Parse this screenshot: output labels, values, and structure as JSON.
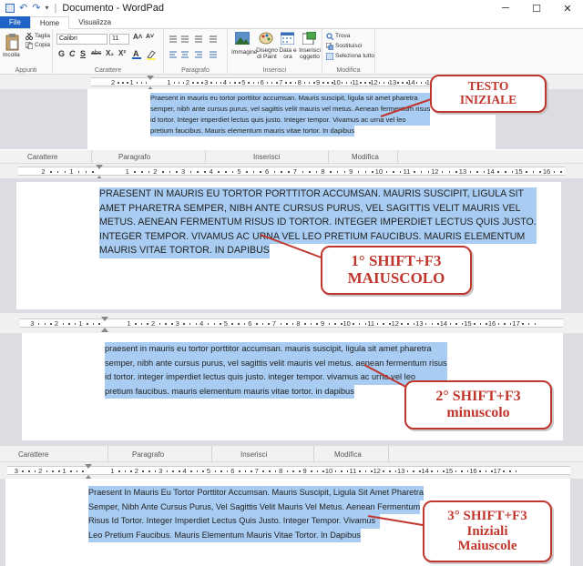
{
  "window": {
    "title": "Documento - WordPad",
    "title_sep": "|",
    "minimize": "─",
    "maximize": "☐",
    "close": "✕"
  },
  "quick_access": {
    "undo": "↶",
    "redo": "↷",
    "dropdown": "▾"
  },
  "tabs": [
    {
      "label": "File"
    },
    {
      "label": "Home"
    },
    {
      "label": "Visualizza"
    }
  ],
  "ribbon": {
    "clipboard": {
      "paste": "Incolla",
      "cut": "Taglia",
      "copy": "Copia",
      "group": "Appunti"
    },
    "font": {
      "family": "Calibri",
      "size": "11",
      "grow": "A˄",
      "shrink": "A˅",
      "bold": "G",
      "italic": "C",
      "underline": "S",
      "strike": "abc",
      "subscript": "X₂",
      "superscript": "X²",
      "group": "Carattere"
    },
    "paragraph": {
      "group": "Paragrafo"
    },
    "insert": {
      "image": "Immagine",
      "paint": "Disegno di Paint",
      "date": "Data e ora",
      "object": "Inserisci oggetto",
      "group": "Inserisci"
    },
    "editing": {
      "find": "Trova",
      "replace": "Sostituisci",
      "select_all": "Seleziona tutto",
      "group": "Modifica"
    }
  },
  "group_bar_labels": [
    "Carattere",
    "Paragrafo",
    "Inserisci",
    "Modifica"
  ],
  "ruler_numbers": [
    "3",
    "2",
    "1",
    "1",
    "2",
    "3",
    "4",
    "5",
    "6",
    "7",
    "8",
    "9",
    "10",
    "11",
    "12",
    "13",
    "14",
    "15",
    "16",
    "17"
  ],
  "panels": {
    "initial": {
      "lines": [
        "Praesent in mauris eu tortor porttitor accumsan. Mauris suscipit, ligula sit amet pharetra",
        "semper, nibh ante cursus purus, vel sagittis velit mauris vel metus. Aenean fermentum risus",
        "id tortor. Integer imperdiet lectus quis justo. Integer tempor. Vivamus ac urna vel leo",
        "pretium faucibus. Mauris elementum mauris vitae tortor. In dapibus"
      ],
      "callout": [
        "TESTO",
        "INIZIALE"
      ]
    },
    "uppercase": {
      "lines": [
        "PRAESENT IN MAURIS EU TORTOR PORTTITOR ACCUMSAN. MAURIS SUSCIPIT, LIGULA SIT",
        "AMET PHARETRA SEMPER, NIBH ANTE CURSUS PURUS, VEL SAGITTIS VELIT MAURIS VEL",
        "METUS. AENEAN FERMENTUM RISUS ID TORTOR. INTEGER IMPERDIET LECTUS QUIS JUSTO.",
        "INTEGER TEMPOR. VIVAMUS AC URNA VEL LEO PRETIUM FAUCIBUS. MAURIS ELEMENTUM",
        "MAURIS VITAE TORTOR. IN DAPIBUS"
      ],
      "callout": [
        "1° SHIFT+F3",
        "MAIUSCOLO"
      ]
    },
    "lowercase": {
      "lines": [
        "praesent in mauris eu tortor porttitor accumsan. mauris suscipit, ligula sit amet pharetra",
        "semper, nibh ante cursus purus, vel sagittis velit mauris vel metus. aenean fermentum risus",
        "id tortor. integer imperdiet lectus quis justo. integer tempor. vivamus ac urna vel leo",
        "pretium faucibus. mauris elementum mauris vitae tortor. in dapibus"
      ],
      "callout": [
        "2° SHIFT+F3",
        "minuscolo"
      ]
    },
    "titlecase": {
      "lines": [
        "Praesent In Mauris Eu Tortor Porttitor Accumsan. Mauris Suscipit, Ligula Sit Amet Pharetra",
        "Semper, Nibh Ante Cursus Purus, Vel Sagittis Velit Mauris Vel Metus. Aenean Fermentum",
        "Risus Id Tortor. Integer Imperdiet Lectus Quis Justo. Integer Tempor. Vivamus",
        "Leo Pretium Faucibus. Mauris Elementum Mauris Vitae Tortor. In Dapibus"
      ],
      "callout": [
        "3° SHIFT+F3",
        "Iniziali",
        "Maiuscole"
      ]
    }
  },
  "colors": {
    "selection": "#a9cdf2",
    "callout": "#c0362c",
    "file_tab": "#1e63c6"
  }
}
